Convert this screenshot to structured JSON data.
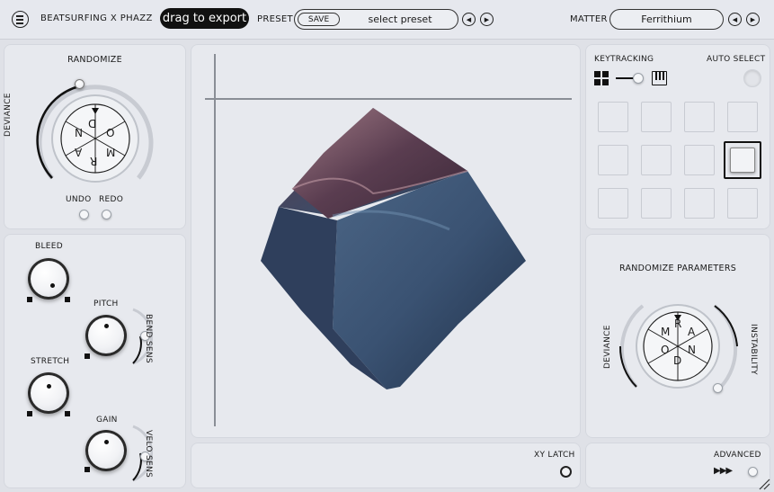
{
  "header": {
    "title": "BEATSURFING X PHAZZ",
    "export_label": "drag to export",
    "preset_label": "PRESET",
    "save_label": "SAVE",
    "preset_name": "select preset",
    "matter_label": "MATTER",
    "matter_name": "Ferrithium"
  },
  "randomize": {
    "title": "RANDOMIZE",
    "deviance_label": "DEVIANCE",
    "wheel_letters": [
      "R",
      "A",
      "N",
      "D",
      "O",
      "M"
    ],
    "undo_label": "UNDO",
    "redo_label": "REDO"
  },
  "controls": {
    "bleed_label": "BLEED",
    "pitch_label": "PITCH",
    "bend_sens_label": "BEND SENS",
    "stretch_label": "STRETCH",
    "gain_label": "GAIN",
    "velo_sens_label": "VELO SENS"
  },
  "xy": {
    "latch_label": "XY LATCH"
  },
  "keytracking": {
    "title": "KEYTRACKING",
    "auto_select_label": "AUTO SELECT",
    "selected_pad": 7
  },
  "randomize_params": {
    "title": "RANDOMIZE PARAMETERS",
    "deviance_label": "DEVIANCE",
    "instability_label": "INSTABILITY",
    "wheel_letters": [
      "R",
      "A",
      "N",
      "D",
      "O",
      "M"
    ]
  },
  "advanced": {
    "label": "ADVANCED",
    "arrows": "▶▶▶"
  },
  "icons": {
    "menu": "hamburger-menu-icon",
    "prev": "chevron-left-icon",
    "next": "chevron-right-icon",
    "grid": "grid-icon",
    "piano": "piano-keys-icon"
  },
  "colors": {
    "accent": "#111111",
    "background": "#dfe1e7",
    "panel": "#e7e9ee"
  }
}
